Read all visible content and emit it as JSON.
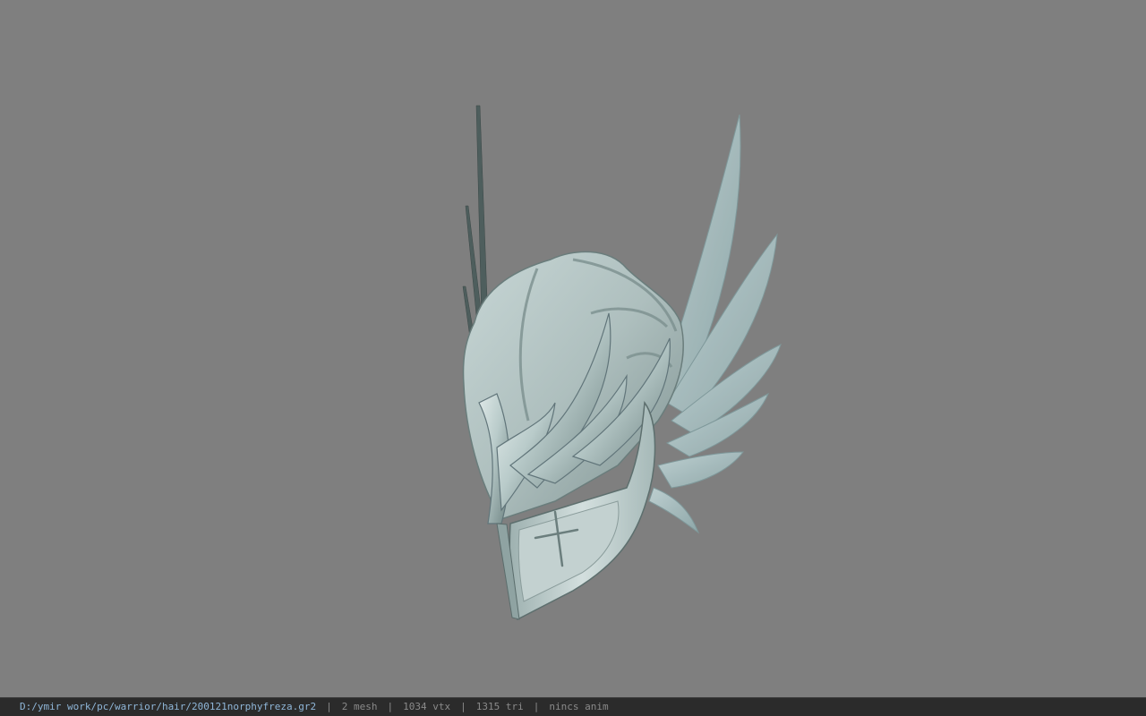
{
  "status": {
    "file_path": "D:/ymir work/pc/warrior/hair/200121norphyfreza.gr2",
    "separator": "|",
    "mesh": "2 mesh",
    "vertices": "1034 vtx",
    "triangles": "1315 tri",
    "anim": "nincs anim"
  },
  "colors": {
    "background": "#7f7f7f",
    "statusbar": "#2b2b2b",
    "path_text": "#8fb6d8",
    "stat_text": "#8a8a8a",
    "metal_light": "#d7e3e2",
    "metal_mid": "#9fb3b2",
    "metal_dark": "#5f7372",
    "wing": "#a9c2c4"
  }
}
